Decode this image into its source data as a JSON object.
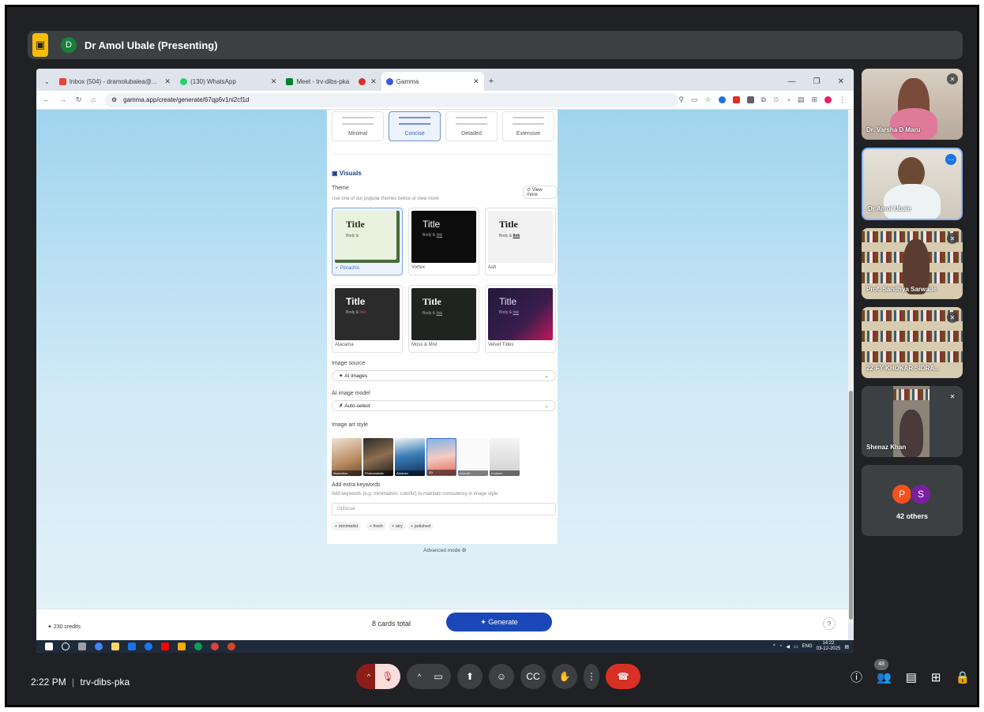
{
  "meeting": {
    "presenter_avatar": "D",
    "presenter_label": "Dr Amol Ubale (Presenting)",
    "time": "2:22 PM",
    "separator": "|",
    "code": "trv-dibs-pka",
    "people_count": "48"
  },
  "browser": {
    "tabs": [
      {
        "label": "Inbox (504) - dramolubalea@...",
        "icon": "gmail-icon"
      },
      {
        "label": "(130) WhatsApp",
        "icon": "whatsapp-icon"
      },
      {
        "label": "Meet - trv-dibs-pka",
        "icon": "meet-icon"
      },
      {
        "label": "",
        "icon": "record-icon"
      },
      {
        "label": "Gamma",
        "icon": "gamma-icon"
      }
    ],
    "url": "gamma.app/create/generate/67qp6v1ni2cf1d",
    "new_tab": "+"
  },
  "gamma": {
    "length_options": [
      "Minimal",
      "Concise",
      "Detailed",
      "Extensive"
    ],
    "selected_length": "Concise",
    "visuals_title": "Visuals",
    "theme_label": "Theme",
    "theme_hint": "Use one of our popular themes below or view more",
    "view_more": "View more",
    "themes": [
      {
        "name": "Pistachio",
        "title": "Title",
        "body": "Body &",
        "link": "link",
        "bg": "#e9f2de",
        "fg": "#1f2a1f"
      },
      {
        "name": "Vortex",
        "title": "Title",
        "body": "Body &",
        "link": "link",
        "bg": "#0c0c0c",
        "fg": "#ffffff"
      },
      {
        "name": "Ash",
        "title": "Title",
        "body": "Body &",
        "link": "link",
        "bg": "#f1f1f1",
        "fg": "#111111"
      },
      {
        "name": "Atacama",
        "title": "Title",
        "body": "Body &",
        "link": "link",
        "bg": "#2b2b2b",
        "fg": "#ffffff"
      },
      {
        "name": "Moss & Mist",
        "title": "Title",
        "body": "Body &",
        "link": "link",
        "bg": "#1f2421",
        "fg": "#ffffff"
      },
      {
        "name": "Velvet Tides",
        "title": "Title",
        "body": "Body &",
        "link": "link",
        "bg": "#1e1a3a",
        "fg": "#e6dcff"
      }
    ],
    "selected_theme": "Pistachio",
    "image_source_label": "Image source",
    "image_source_value": "AI images",
    "image_model_label": "AI image model",
    "image_model_value": "Auto-select",
    "art_style_label": "Image art style",
    "art_styles": [
      "Illustration",
      "Photorealistic",
      "Abstract",
      "3D",
      "Line Art",
      "Custom"
    ],
    "keywords_label": "Add extra keywords",
    "keywords_hint": "Add keywords (e.g. minimalism, colorful) to maintain consistency in image style.",
    "keywords_placeholder": "Optional",
    "keyword_chips": [
      "+ minimalist",
      "+ fresh",
      "+ airy",
      "+ polished"
    ],
    "advanced_mode": "Advanced mode",
    "credits": "230 credits",
    "cards_total": "8 cards total",
    "generate": "Generate",
    "help": "?"
  },
  "taskbar": {
    "lang": "ENG",
    "time": "14:22",
    "date": "03-12-2025"
  },
  "participants": [
    "Dr. Varsha D Maru",
    "Dr Amol Ubale",
    "Prof. Sandhya Sarwade",
    "22-FY-KHOKAR SIDRA...",
    "Shenaz Khan"
  ],
  "others": {
    "avatars": [
      "P",
      "S"
    ],
    "label": "42 others"
  },
  "colors": {
    "accent": "#1b48b8",
    "end_call": "#d93025",
    "presenter_icon": "#fbbc04"
  }
}
